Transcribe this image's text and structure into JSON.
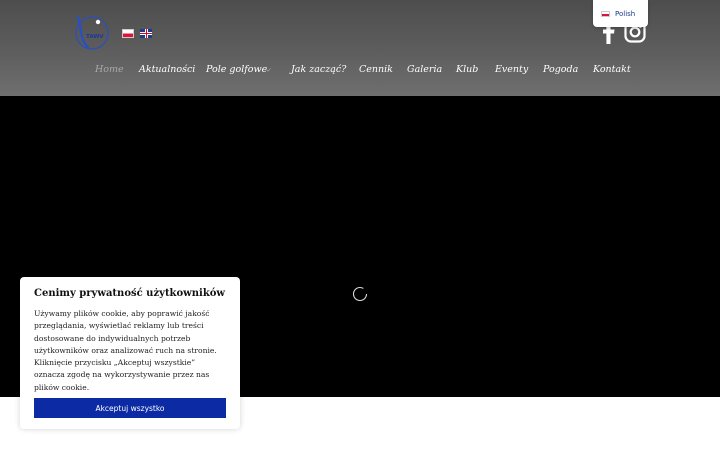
{
  "header": {
    "logo_text": "TAWV",
    "languages": [
      {
        "code": "pl",
        "label": "Polish"
      },
      {
        "code": "en",
        "label": "English"
      }
    ],
    "language_dropdown": {
      "selected": "Polish"
    }
  },
  "nav": {
    "items": [
      {
        "label": "Home",
        "active": true
      },
      {
        "label": "Aktualności"
      },
      {
        "label": "Pole golfowe",
        "has_submenu": true
      },
      {
        "label": "Jak zacząć?"
      },
      {
        "label": "Cennik"
      },
      {
        "label": "Galeria"
      },
      {
        "label": "Klub"
      },
      {
        "label": "Eventy"
      },
      {
        "label": "Pogoda"
      },
      {
        "label": "Kontakt"
      }
    ]
  },
  "hero": {
    "state": "loading"
  },
  "cookie": {
    "title": "Cenimy prywatność użytkowników",
    "text": "Używamy plików cookie, aby poprawić jakość przeglądania, wyświetlać reklamy lub treści dostosowane do indywidualnych potrzeb użytkowników oraz analizować ruch na stronie. Kliknięcie przycisku „Akceptuj wszystkie” oznacza zgodę na wykorzystywanie przez nas plików cookie.",
    "accept_label": "Akceptuj wszystko"
  },
  "colors": {
    "header_bg": "#5a5a5a",
    "hero_bg": "#000000",
    "accept_button": "#0b2aa3",
    "nav_active": "#a8a8a8"
  },
  "icons": [
    "logo-icon",
    "flag-pl-icon",
    "flag-en-icon",
    "facebook-icon",
    "instagram-icon",
    "chevron-down-icon",
    "spinner-icon"
  ]
}
